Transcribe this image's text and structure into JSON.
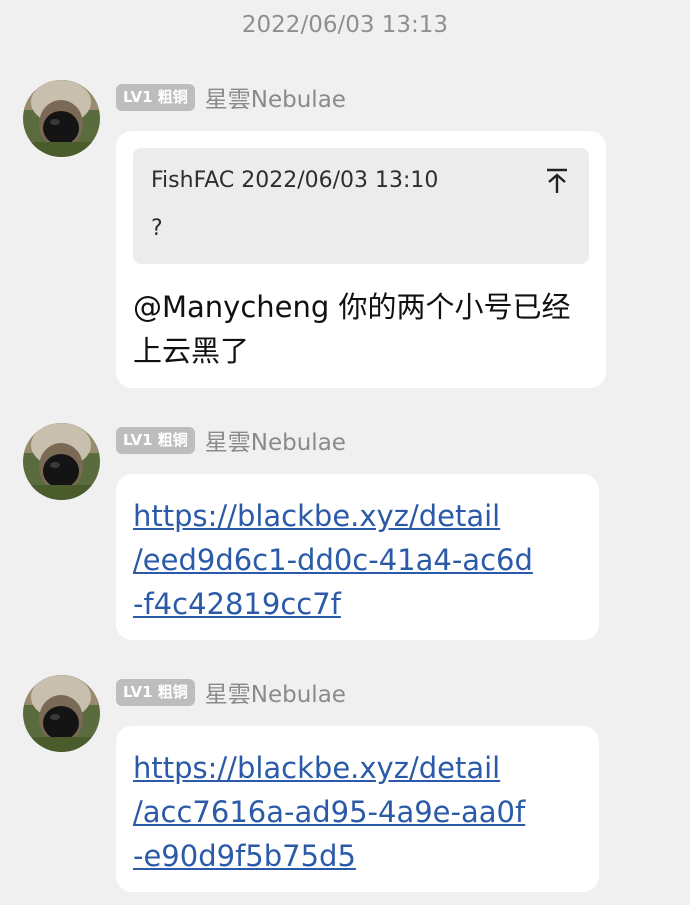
{
  "timestamp": "2022/06/03 13:13",
  "messages": [
    {
      "badge": "LV1 粗铜",
      "sender": "星雲Nebulae",
      "quote": {
        "author": "FishFAC",
        "time": "2022/06/03 13:10",
        "text": "?"
      },
      "text": "@Manycheng 你的两个小号已经上云黑了"
    },
    {
      "badge": "LV1 粗铜",
      "sender": "星雲Nebulae",
      "link": "https://blackbe.xyz/detail\n/eed9d6c1-dd0c-41a4-ac6d\n-f4c42819cc7f"
    },
    {
      "badge": "LV1 粗铜",
      "sender": "星雲Nebulae",
      "link": "https://blackbe.xyz/detail\n/acc7616a-ad95-4a9e-aa0f\n-e90d9f5b75d5"
    }
  ],
  "icons": {
    "quote_jump": "arrow-up-to-top-icon",
    "avatar": "dog-nose-avatar"
  },
  "colors": {
    "background": "#f0f0f0",
    "bubble": "#ffffff",
    "quote_bg": "#ececec",
    "badge_bg": "#bdbdbd",
    "link": "#2a5aa8",
    "meta_text": "#8a8a8a"
  }
}
